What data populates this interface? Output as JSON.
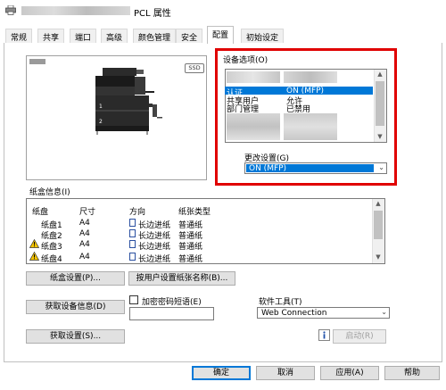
{
  "window": {
    "title_suffix": "PCL 属性"
  },
  "tabs": [
    "常规",
    "共享",
    "端口",
    "高级",
    "颜色管理",
    "安全",
    "配置",
    "初始设定"
  ],
  "device_options": {
    "group_label": "设备选项(O)",
    "rows": [
      {
        "name": "认证",
        "value": "ON (MFP)",
        "selected": true
      },
      {
        "name": "共享用户",
        "value": "允许",
        "selected": false
      },
      {
        "name": "部门管理",
        "value": "已禁用",
        "selected": false
      }
    ],
    "change_label": "更改设置(G)",
    "change_value": "ON (MFP)",
    "ssd_label": "SSD"
  },
  "tray_info": {
    "group_label": "纸盒信息(I)",
    "headers": [
      "纸盘",
      "尺寸",
      "方向",
      "纸张类型"
    ],
    "rows": [
      {
        "tray": "纸盘1",
        "size": "A4",
        "direction": "长边进纸",
        "type": "普通纸",
        "warning": false
      },
      {
        "tray": "纸盘2",
        "size": "A4",
        "direction": "长边进纸",
        "type": "普通纸",
        "warning": false
      },
      {
        "tray": "纸盘3",
        "size": "A4",
        "direction": "长边进纸",
        "type": "普通纸",
        "warning": true
      },
      {
        "tray": "纸盘4",
        "size": "A4",
        "direction": "长边进纸",
        "type": "普通纸",
        "warning": true
      }
    ]
  },
  "buttons": {
    "tray_settings": "纸盒设置(P)...",
    "paper_name": "按用户设置纸张名称(B)...",
    "acquire_device_info": "获取设备信息(D)",
    "acquire_settings": "获取设置(S)...",
    "start": "启动(R)",
    "ok": "确定",
    "cancel": "取消",
    "apply": "应用(A)",
    "help": "帮助"
  },
  "encrypt": {
    "label": "加密密码短语(E)",
    "checked": false,
    "value": ""
  },
  "software_tool": {
    "label": "软件工具(T)",
    "value": "Web Connection"
  },
  "colors": {
    "selection": "#0078d7",
    "highlight_border": "#e00000",
    "button_face": "#e1e1e1"
  }
}
